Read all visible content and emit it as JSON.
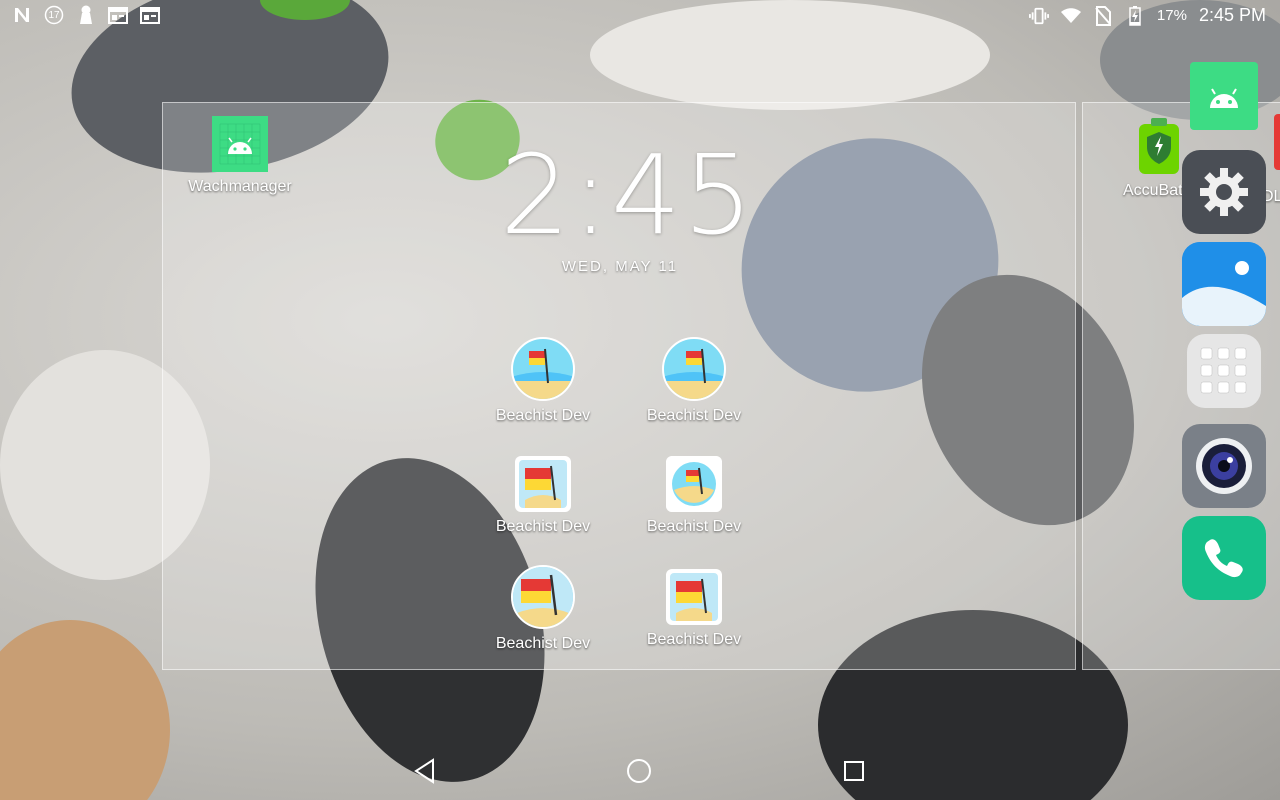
{
  "status_bar": {
    "left_icons": [
      "n-notification-icon",
      "calendar-17-icon",
      "keyhole-icon",
      "calendar-icon",
      "calendar-icon"
    ],
    "calendar_day": "17",
    "battery": "17%",
    "time": "2:45 PM",
    "right_icons": [
      "vibrate-icon",
      "wifi-icon",
      "no-sim-icon",
      "battery-charging-icon"
    ]
  },
  "clock_widget": {
    "time": "2:45",
    "date": "WED, MAY 11"
  },
  "home": {
    "apps": [
      {
        "label": "Wachmanager",
        "icon": "android-icon"
      },
      {
        "label": "Beachist Dev",
        "icon": "beach-flag-round-icon"
      },
      {
        "label": "Beachist Dev",
        "icon": "beach-flag-round-icon"
      },
      {
        "label": "Beachist Dev",
        "icon": "beach-flag-square-icon"
      },
      {
        "label": "Beachist Dev",
        "icon": "beach-flag-square-round-icon"
      },
      {
        "label": "Beachist Dev",
        "icon": "beach-flag-round-large-icon"
      },
      {
        "label": "Beachist Dev",
        "icon": "beach-flag-square-icon"
      }
    ],
    "next_page_apps": [
      {
        "label": "AccuBatt",
        "icon": "battery-shield-icon"
      },
      {
        "label": "DL",
        "icon": "red-app-icon"
      }
    ]
  },
  "dock": {
    "items": [
      {
        "name": "android-app",
        "icon": "android-icon",
        "color": "#3ddc84"
      },
      {
        "name": "settings",
        "icon": "gear-icon",
        "color": "#4a4e55"
      },
      {
        "name": "gallery",
        "icon": "mountain-icon",
        "color": "#1f8fe8"
      },
      {
        "name": "app-drawer",
        "icon": "grid-icon",
        "color": "#e6e6e6"
      },
      {
        "name": "camera",
        "icon": "camera-lens-icon",
        "color": "#7a8088"
      },
      {
        "name": "phone",
        "icon": "phone-icon",
        "color": "#16c08a"
      }
    ]
  },
  "nav_bar": {
    "buttons": [
      "back-icon",
      "home-icon",
      "recents-icon"
    ]
  }
}
